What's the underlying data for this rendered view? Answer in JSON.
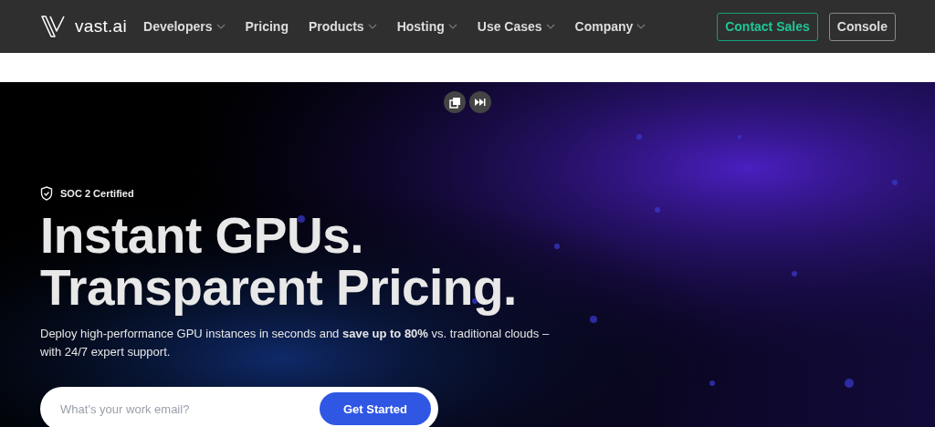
{
  "nav": {
    "brand": "vast.ai",
    "items": [
      {
        "label": "Developers",
        "has_menu": true
      },
      {
        "label": "Pricing",
        "has_menu": false
      },
      {
        "label": "Products",
        "has_menu": true
      },
      {
        "label": "Hosting",
        "has_menu": true
      },
      {
        "label": "Use Cases",
        "has_menu": true
      },
      {
        "label": "Company",
        "has_menu": true
      }
    ],
    "actions": [
      {
        "label": "Contact Sales",
        "kind": "accent"
      },
      {
        "label": "Console",
        "kind": "plain"
      }
    ]
  },
  "hero": {
    "badge": "SOC 2 Certified",
    "title_lines": [
      "Instant GPUs.",
      "Transparent Pricing."
    ],
    "subtitle": "Deploy high-performance GPU instances in seconds and **save up to 80%** vs. traditional clouds – with 24/7 expert support.",
    "signup": {
      "placeholder": "What’s your work email?",
      "button": "Get Started"
    }
  }
}
